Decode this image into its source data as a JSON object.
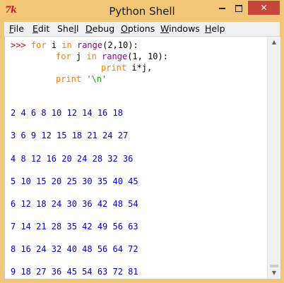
{
  "window": {
    "title": "Python Shell",
    "app_icon_text": "7k",
    "accent_color": "#f1c676",
    "close_color": "#c7463c"
  },
  "menu": [
    {
      "label": "File",
      "underline": "F",
      "rest": "ile"
    },
    {
      "label": "Edit",
      "underline": "E",
      "rest": "dit"
    },
    {
      "label": "Shell",
      "pre": "She",
      "underline": "l",
      "rest": "l"
    },
    {
      "label": "Debug",
      "underline": "D",
      "rest": "ebug"
    },
    {
      "label": "Options",
      "underline": "O",
      "rest": "ptions"
    },
    {
      "label": "Windows",
      "underline": "W",
      "rest": "indows"
    },
    {
      "label": "Help",
      "underline": "H",
      "rest": "elp"
    }
  ],
  "code": {
    "prompt": ">>>",
    "line1": {
      "kw1": "for",
      "a": " i ",
      "kw2": "in",
      "b": " ",
      "bi": "range",
      "c": "(2,10):"
    },
    "line2": {
      "kw1": "for",
      "a": " j ",
      "kw2": "in",
      "b": " ",
      "bi": "range",
      "c": "(1, 10):"
    },
    "line3": {
      "kw1": "print",
      "a": " i*j,"
    },
    "line4": {
      "kw1": "print",
      "a": " ",
      "str": "'\\n'"
    }
  },
  "output": [
    "2 4 6 8 10 12 14 16 18",
    "3 6 9 12 15 18 21 24 27",
    "4 8 12 16 20 24 28 32 36",
    "5 10 15 20 25 30 35 40 45",
    "6 12 18 24 30 36 42 48 54",
    "7 14 21 28 35 42 49 56 63",
    "8 16 24 32 40 48 56 64 72",
    "9 18 27 36 45 54 63 72 81"
  ]
}
